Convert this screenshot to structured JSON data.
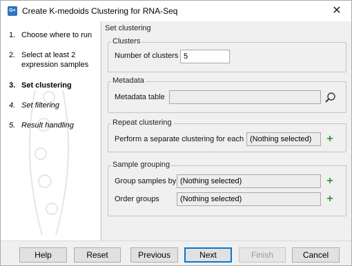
{
  "window": {
    "title": "Create K-medoids Clustering for RNA-Seq",
    "icon_text": "G+",
    "close_glyph": "✕"
  },
  "steps": [
    {
      "num": "1.",
      "label": "Choose where to run",
      "style": "normal"
    },
    {
      "num": "2.",
      "label": "Select at least 2",
      "label2": "expression samples",
      "style": "normal"
    },
    {
      "num": "3.",
      "label": "Set clustering",
      "style": "bold"
    },
    {
      "num": "4.",
      "label": "Set filtering",
      "style": "italic"
    },
    {
      "num": "5.",
      "label": "Result handling",
      "style": "italic"
    }
  ],
  "main": {
    "section_title": "Set clustering",
    "clusters": {
      "legend": "Clusters",
      "number_label": "Number of clusters",
      "number_value": "5"
    },
    "metadata": {
      "legend": "Metadata",
      "table_label": "Metadata table",
      "table_value": "",
      "browse_icon": "browse-icon"
    },
    "repeat": {
      "legend": "Repeat clustering",
      "separate_label": "Perform a separate clustering for each",
      "separate_value": "(Nothing selected)"
    },
    "grouping": {
      "legend": "Sample grouping",
      "group_by_label": "Group samples by",
      "group_by_value": "(Nothing selected)",
      "order_label": "Order groups",
      "order_value": "(Nothing selected)"
    },
    "plus_glyph": "+"
  },
  "buttons": {
    "help": "Help",
    "reset": "Reset",
    "previous": "Previous",
    "next": "Next",
    "finish": "Finish",
    "cancel": "Cancel"
  },
  "colors": {
    "accent": "#0078d7",
    "plus_green": "#2e9a2e",
    "app_icon": "#2f74c0"
  }
}
